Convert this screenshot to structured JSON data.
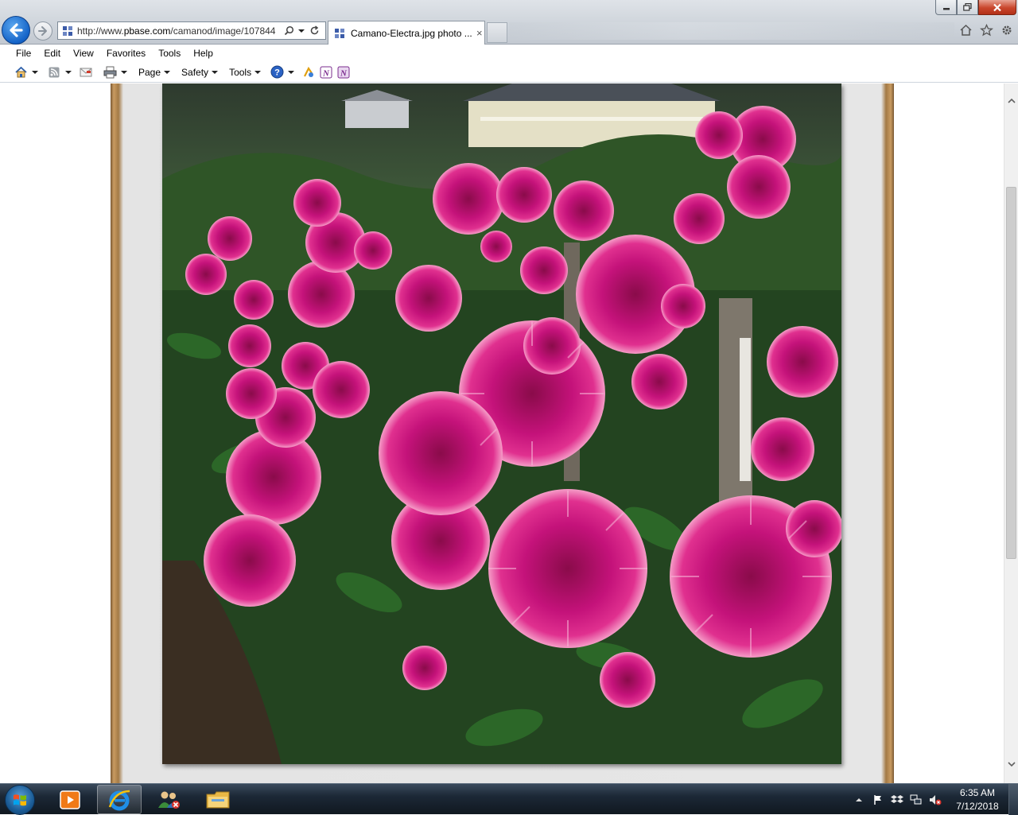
{
  "browser": {
    "address": {
      "prefix": "http://www.",
      "domain": "pbase.com",
      "path": "/camanod/image/107844"
    },
    "tab": {
      "title": "Camano-Electra.jpg photo ...",
      "close_glyph": "×"
    },
    "menu": [
      "File",
      "Edit",
      "View",
      "Favorites",
      "Tools",
      "Help"
    ],
    "command_bar": {
      "page_label": "Page",
      "safety_label": "Safety",
      "tools_label": "Tools"
    },
    "icons": {
      "back": "back-arrow-icon",
      "forward": "forward-arrow-icon",
      "home": "home-icon",
      "favorites": "star-icon",
      "settings": "gear-icon",
      "feeds": "rss-icon",
      "mail": "mail-icon",
      "print": "printer-icon",
      "help": "help-icon",
      "research": "research-icon",
      "onenote": "onenote-icon"
    },
    "accent": "#1463c7"
  },
  "content": {
    "image_subject": "photo"
  },
  "taskbar": {
    "clock_time": "6:35 AM",
    "clock_date": "7/12/2018",
    "apps": [
      "windows-media-player-icon",
      "internet-explorer-icon",
      "users-icon",
      "file-explorer-icon"
    ]
  }
}
